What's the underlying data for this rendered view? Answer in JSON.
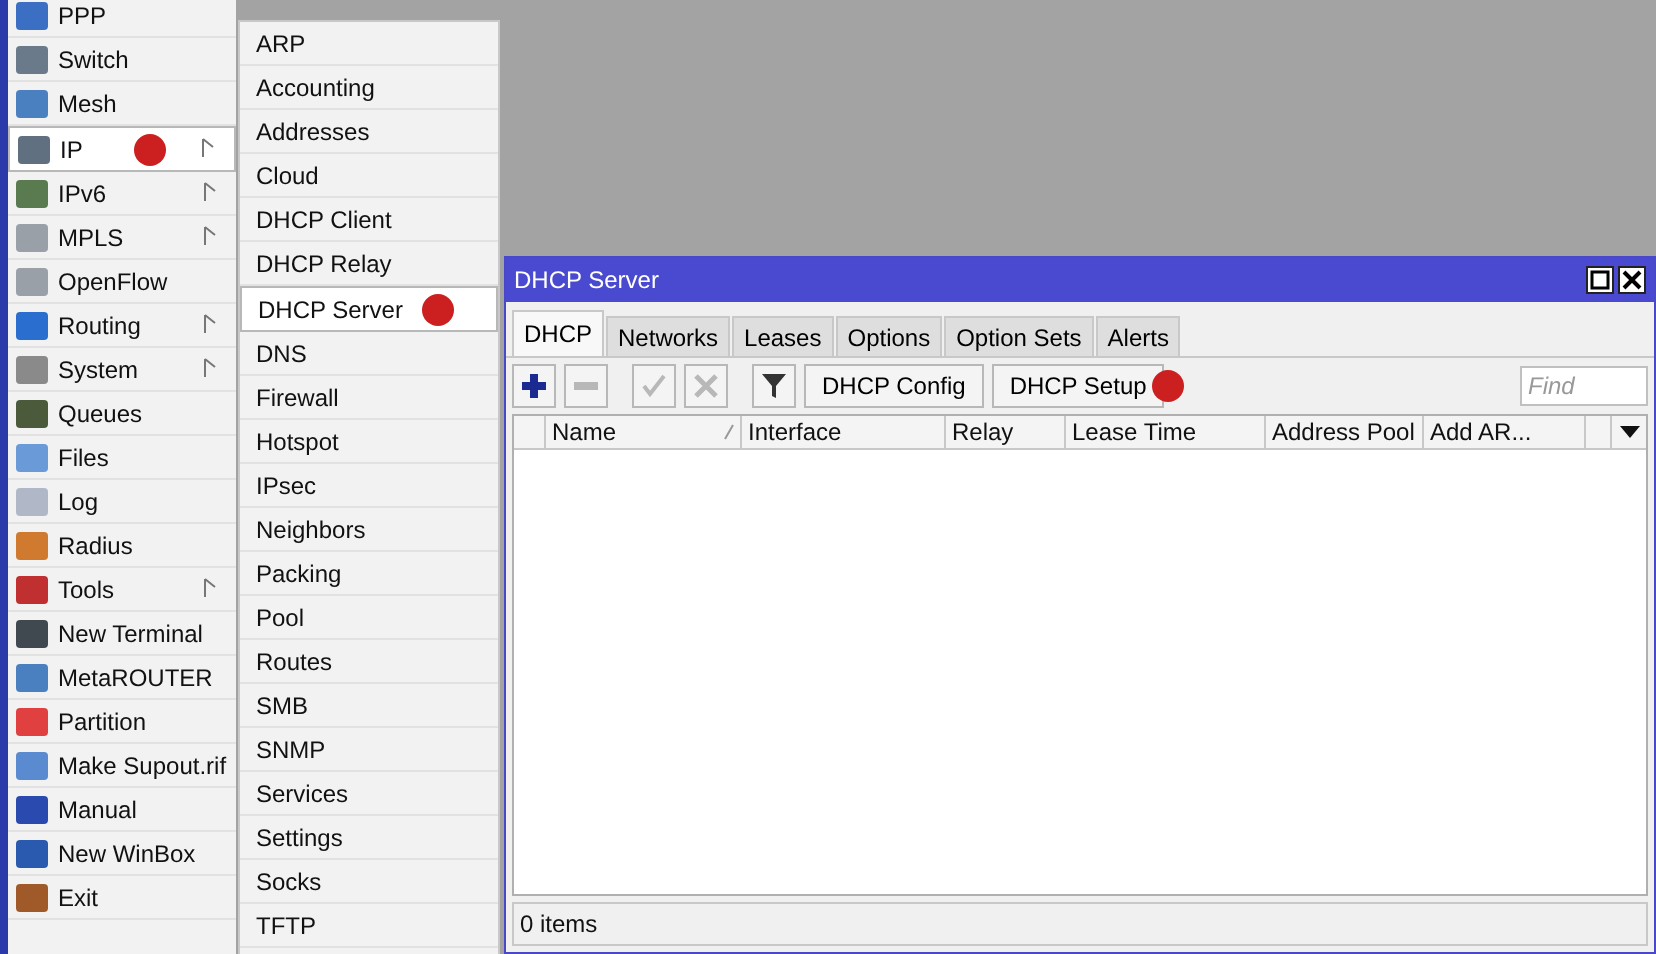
{
  "main_menu": [
    {
      "label": "PPP",
      "submenu": false,
      "selected": false,
      "marked": false
    },
    {
      "label": "Switch",
      "submenu": false,
      "selected": false,
      "marked": false
    },
    {
      "label": "Mesh",
      "submenu": false,
      "selected": false,
      "marked": false
    },
    {
      "label": "IP",
      "submenu": true,
      "selected": true,
      "marked": true
    },
    {
      "label": "IPv6",
      "submenu": true,
      "selected": false,
      "marked": false
    },
    {
      "label": "MPLS",
      "submenu": true,
      "selected": false,
      "marked": false
    },
    {
      "label": "OpenFlow",
      "submenu": false,
      "selected": false,
      "marked": false
    },
    {
      "label": "Routing",
      "submenu": true,
      "selected": false,
      "marked": false
    },
    {
      "label": "System",
      "submenu": true,
      "selected": false,
      "marked": false
    },
    {
      "label": "Queues",
      "submenu": false,
      "selected": false,
      "marked": false
    },
    {
      "label": "Files",
      "submenu": false,
      "selected": false,
      "marked": false
    },
    {
      "label": "Log",
      "submenu": false,
      "selected": false,
      "marked": false
    },
    {
      "label": "Radius",
      "submenu": false,
      "selected": false,
      "marked": false
    },
    {
      "label": "Tools",
      "submenu": true,
      "selected": false,
      "marked": false
    },
    {
      "label": "New Terminal",
      "submenu": false,
      "selected": false,
      "marked": false
    },
    {
      "label": "MetaROUTER",
      "submenu": false,
      "selected": false,
      "marked": false
    },
    {
      "label": "Partition",
      "submenu": false,
      "selected": false,
      "marked": false
    },
    {
      "label": "Make Supout.rif",
      "submenu": false,
      "selected": false,
      "marked": false
    },
    {
      "label": "Manual",
      "submenu": false,
      "selected": false,
      "marked": false
    },
    {
      "label": "New WinBox",
      "submenu": false,
      "selected": false,
      "marked": false
    },
    {
      "label": "Exit",
      "submenu": false,
      "selected": false,
      "marked": false
    }
  ],
  "ip_submenu": [
    {
      "label": "ARP",
      "selected": false,
      "marked": false
    },
    {
      "label": "Accounting",
      "selected": false,
      "marked": false
    },
    {
      "label": "Addresses",
      "selected": false,
      "marked": false
    },
    {
      "label": "Cloud",
      "selected": false,
      "marked": false
    },
    {
      "label": "DHCP Client",
      "selected": false,
      "marked": false
    },
    {
      "label": "DHCP Relay",
      "selected": false,
      "marked": false
    },
    {
      "label": "DHCP Server",
      "selected": true,
      "marked": true
    },
    {
      "label": "DNS",
      "selected": false,
      "marked": false
    },
    {
      "label": "Firewall",
      "selected": false,
      "marked": false
    },
    {
      "label": "Hotspot",
      "selected": false,
      "marked": false
    },
    {
      "label": "IPsec",
      "selected": false,
      "marked": false
    },
    {
      "label": "Neighbors",
      "selected": false,
      "marked": false
    },
    {
      "label": "Packing",
      "selected": false,
      "marked": false
    },
    {
      "label": "Pool",
      "selected": false,
      "marked": false
    },
    {
      "label": "Routes",
      "selected": false,
      "marked": false
    },
    {
      "label": "SMB",
      "selected": false,
      "marked": false
    },
    {
      "label": "SNMP",
      "selected": false,
      "marked": false
    },
    {
      "label": "Services",
      "selected": false,
      "marked": false
    },
    {
      "label": "Settings",
      "selected": false,
      "marked": false
    },
    {
      "label": "Socks",
      "selected": false,
      "marked": false
    },
    {
      "label": "TFTP",
      "selected": false,
      "marked": false
    }
  ],
  "window": {
    "title": "DHCP Server",
    "tabs": [
      {
        "label": "DHCP",
        "selected": true
      },
      {
        "label": "Networks",
        "selected": false
      },
      {
        "label": "Leases",
        "selected": false
      },
      {
        "label": "Options",
        "selected": false
      },
      {
        "label": "Option Sets",
        "selected": false
      },
      {
        "label": "Alerts",
        "selected": false
      }
    ],
    "toolbar": [
      {
        "kind": "add",
        "disabled": false
      },
      {
        "kind": "remove",
        "disabled": true
      },
      {
        "kind": "enable",
        "disabled": true
      },
      {
        "kind": "disable",
        "disabled": true
      },
      {
        "kind": "filter",
        "disabled": false
      },
      {
        "kind": "text",
        "label": "DHCP Config",
        "marked": false
      },
      {
        "kind": "text",
        "label": "DHCP Setup",
        "marked": true
      }
    ],
    "search": {
      "placeholder": "Find"
    },
    "table": {
      "columns": [
        "Name",
        "Interface",
        "Relay",
        "Lease Time",
        "Address Pool",
        "Add AR..."
      ]
    },
    "status_bar": "0 items"
  }
}
